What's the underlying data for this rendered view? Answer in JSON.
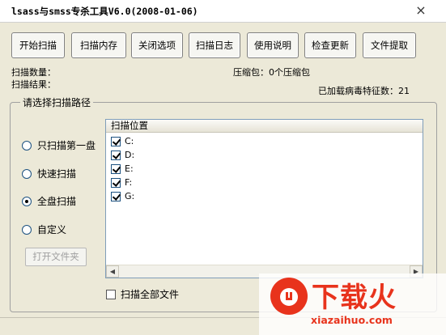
{
  "window": {
    "title": "lsass与smss专杀工具V6.0(2008-01-06)",
    "close_glyph": "×"
  },
  "toolbar": {
    "buttons": [
      {
        "label": "开始扫描"
      },
      {
        "label": "扫描内存"
      },
      {
        "label": "关闭选项"
      },
      {
        "label": "扫描日志"
      },
      {
        "label": "使用说明"
      },
      {
        "label": "检查更新"
      },
      {
        "label": "文件提取"
      }
    ]
  },
  "stats": {
    "scan_count_label": "扫描数量：",
    "scan_result_label": "扫描结果：",
    "archive": "压缩包：0个压缩包",
    "signatures": "已加载病毒特征数：21"
  },
  "path_group": {
    "title": "请选择扫描路径",
    "options": [
      {
        "label": "只扫描第一盘",
        "selected": false
      },
      {
        "label": "快速扫描",
        "selected": false
      },
      {
        "label": "全盘扫描",
        "selected": true
      },
      {
        "label": "自定义",
        "selected": false
      }
    ],
    "open_folder_label": "打开文件夹",
    "list_header": "扫描位置",
    "drives": [
      {
        "label": "C:",
        "checked": true
      },
      {
        "label": "D:",
        "checked": true
      },
      {
        "label": "E:",
        "checked": true
      },
      {
        "label": "F:",
        "checked": true
      },
      {
        "label": "G:",
        "checked": true
      }
    ],
    "scan_all_label": "扫描全部文件",
    "scan_all_checked": false
  },
  "watermark": {
    "brand": "下载火",
    "url": "xiazaihuo.com",
    "color": "#e8331c"
  },
  "icons": {
    "scroll_left": "◀",
    "scroll_right": "▶"
  }
}
